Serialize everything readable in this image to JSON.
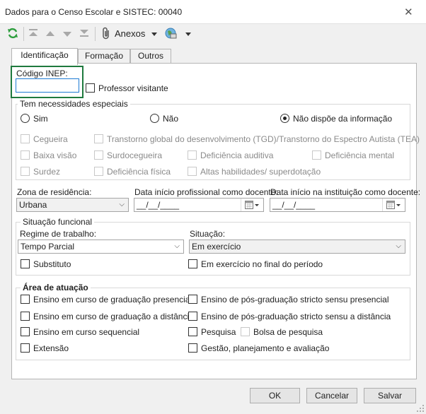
{
  "window": {
    "title": "Dados para o Censo Escolar e SISTEC: 00040",
    "close": "✕"
  },
  "toolbar": {
    "anexos": "Anexos"
  },
  "tabs": [
    {
      "label": "Identificação"
    },
    {
      "label": "Formação"
    },
    {
      "label": "Outros"
    }
  ],
  "inep": {
    "label": "Código INEP:",
    "value": ""
  },
  "visitante": {
    "label": "Professor visitante"
  },
  "necessidades": {
    "title": "Tem necessidades especiais",
    "radios": [
      "Sim",
      "Não",
      "Não dispõe da informação"
    ],
    "items": [
      "Cegueira",
      "Transtorno global do desenvolvimento (TGD)/Transtorno do Espectro Autista (TEA)",
      "Baixa visão",
      "Surdocegueira",
      "Deficiência auditiva",
      "Deficiência mental",
      "Surdez",
      "Deficiência física",
      "Altas habilidades/ superdotação"
    ]
  },
  "zona": {
    "label": "Zona de residência:",
    "value": "Urbana"
  },
  "data_prof": {
    "label": "Data início profissional como docente:",
    "value": "__/__/____"
  },
  "data_inst": {
    "label": "Data início na instituição como docente:",
    "value": "__/__/____"
  },
  "situacao_funcional": {
    "title": "Situação funcional",
    "regime_label": "Regime de trabalho:",
    "regime_value": "Tempo Parcial",
    "situacao_label": "Situação:",
    "situacao_value": "Em exercício",
    "substituto": "Substituto",
    "em_exercicio_final": "Em exercício no final do período"
  },
  "area": {
    "title": "Área de atuação",
    "items": [
      "Ensino em curso de graduação presencial",
      "Ensino de pós-graduação stricto sensu presencial",
      "Ensino em curso de graduação a distância",
      "Ensino de pós-graduação stricto sensu a distância",
      "Ensino em curso sequencial",
      "Pesquisa",
      "Bolsa de pesquisa",
      "Extensão",
      "Gestão, planejamento e avaliação"
    ]
  },
  "buttons": {
    "ok": "OK",
    "cancel": "Cancelar",
    "save": "Salvar"
  },
  "colors": {
    "highlight": "#1f7a3e",
    "refresh": "#2e9e3e"
  }
}
